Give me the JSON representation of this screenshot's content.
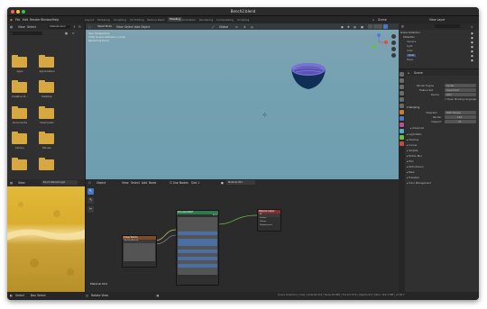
{
  "window": {
    "title": "Bench2.blend"
  },
  "menu": {
    "items": [
      "File",
      "Edit",
      "Render",
      "Window",
      "Help"
    ],
    "workspaces": [
      "Layout",
      "Modeling",
      "Sculpting",
      "UV Editing",
      "Texture Paint",
      "Shading",
      "Animation",
      "Rendering",
      "Compositing",
      "Scripting"
    ],
    "active_workspace": "Shading",
    "scene": "Scene",
    "view_layer": "View Layer"
  },
  "file_browser": {
    "header": [
      "View",
      "Select"
    ],
    "path": "/Users/uuuun/",
    "folders": [
      "Apps",
      "Applications",
      "Creative Cl...",
      "Desktop",
      "Documents",
      "Downloads",
      "Library",
      "Movies"
    ]
  },
  "viewport": {
    "mode": "Object Mode",
    "menus": [
      "View",
      "Select",
      "Add",
      "Object"
    ],
    "shading": "Global",
    "info": [
      "User Perspective",
      "(122) Scene Collection | bowl",
      "Rendering Done"
    ]
  },
  "image_editor": {
    "image_name": "Bench+Backed-Ingot"
  },
  "node_editor": {
    "menus": [
      "Object",
      "View",
      "Select",
      "Add",
      "Node"
    ],
    "use_nodes_label": "Use Nodes",
    "slot": "Slot 1",
    "material": "Material.004",
    "label_bottom": "Material.004",
    "nodes": {
      "bsdf": {
        "title": "Principled BSDF",
        "output": "BSDF"
      },
      "output": {
        "title": "Material Output",
        "rows": [
          "All",
          "Surface",
          "Volume",
          "Displacement"
        ]
      },
      "texture": {
        "title": "Image Texture",
        "image": "Bench+Backed"
      }
    }
  },
  "outliner": {
    "items": [
      "Scene Collection",
      "Collection",
      "Camera",
      "Light",
      "Cube",
      "bowl",
      "Plane"
    ]
  },
  "properties": {
    "scene_name": "Scene",
    "render_engine_label": "Render Engine",
    "render_engine": "Cycles",
    "feature_set_label": "Feature Set",
    "feature_set": "Supported",
    "device_label": "Device",
    "device": "GPU",
    "osl_label": "Open Shading Language",
    "sections": [
      "Sampling",
      "Light Paths",
      "Volumes",
      "Curves",
      "Simplify",
      "Motion Blur",
      "Film",
      "Performance",
      "Bake",
      "Freestyle",
      "Color Management"
    ],
    "sampling": {
      "integrator_label": "Integrator",
      "integrator": "Path Tracing",
      "render_label": "Render",
      "render": "128",
      "viewport_label": "Viewport",
      "viewport": "32",
      "advanced": "Advanced"
    }
  },
  "statusbar": {
    "left": [
      "Select",
      "Box Select"
    ],
    "mid": "Rotate View",
    "right": "Scene Collection | bowl | Verts:64,018 | Faces:63,988 | Tris:127,976 | Objects:0/4 | Mem: 118.3 MiB | v2.82.7"
  }
}
